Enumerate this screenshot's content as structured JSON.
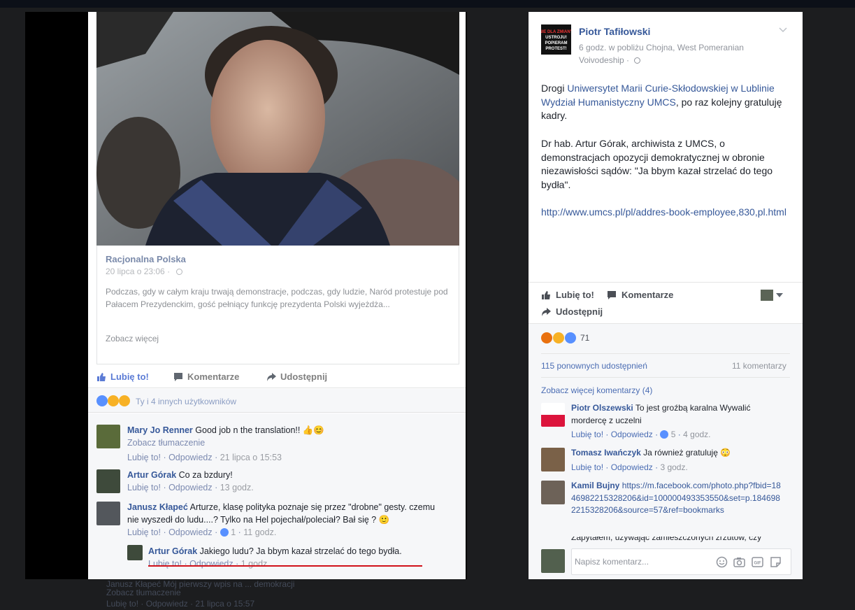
{
  "left": {
    "shared_post": {
      "source": "Racjonalna Polska",
      "date": "20 lipca o 23:06 · ",
      "excerpt": "Podczas, gdy w całym kraju trwają demonstracje, podczas, gdy ludzie, Naród protestuje pod Pałacem Prezydenckim, gość pełniący funkcję prezydenta Polski wyjeżdża...",
      "see_more": "Zobacz więcej"
    },
    "actions": {
      "like": "Lubię to!",
      "comment": "Komentarze",
      "share": "Udostępnij"
    },
    "reactions_text": "Ty i 4 innych użytkowników",
    "comments": [
      {
        "name": "Mary Jo Renner",
        "text": "Good job n the translation!! 👍😊",
        "translate": "Zobacz tłumaczenie",
        "like": "Lubię to!",
        "reply": "Odpowiedz",
        "date": "21 lipca o 15:53"
      },
      {
        "name": "Artur Górak",
        "text": "Co za bzdury!",
        "like": "Lubię to!",
        "reply": "Odpowiedz",
        "date": "13 godz."
      },
      {
        "name": "Janusz Kłapeć",
        "text_line1": "Arturze, klasę polityka poznaje się przez \"drobne\" gesty. czemu",
        "text_line2": "nie wyszedł do ludu....? Tylko na Hel pojechał/poleciał? Bał się ? 🙂",
        "like": "Lubię to!",
        "reply": "Odpowiedz",
        "reactions": "1",
        "date": "11 godz."
      },
      {
        "name": "Artur Górak",
        "text": "Jakiego ludu? Ja bbym kazał strzelać do tego bydła.",
        "like": "Lubię to!",
        "reply": "Odpowiedz",
        "date": "1 godz."
      }
    ],
    "ghost": {
      "line1": "Janusz Kłapeć  Mój pierwszy wpis na ... demokracji",
      "line2": "Zobacz tłumaczenie",
      "line3": "Lubię to!  ·  Odpowiedz  ·  21 lipca o 15:57"
    }
  },
  "right": {
    "author": "Piotr Tafiłowski",
    "avatar_caption": "NIE DLA ZMIANY USTROJU! POPIERAM PROTEST!",
    "meta": "6 godz. w pobliżu Chojna, West Pomeranian Voivodeship · ",
    "body": {
      "p1_a": "Drogi ",
      "p1_link": "Uniwersytet Marii Curie-Skłodowskiej w Lublinie Wydział Humanistyczny UMCS",
      "p1_b": ", po raz kolejny gratuluję kadry.",
      "p2": "Dr hab. Artur Górak, archiwista z UMCS, o demonstracjach opozycji demokratycznej w obronie niezawisłości sądów: \"Ja bbym kazał strzelać do tego bydła\".",
      "p3_link": "http://www.umcs.pl/pl/addres-book-employee,830,pl.html"
    },
    "actions": {
      "like": "Lubię to!",
      "comment": "Komentarze",
      "share": "Udostępnij"
    },
    "reactions_count": "71",
    "shares": "115 ponownych udostępnień",
    "comments_count": "11 komentarzy",
    "more_comments": "Zobacz więcej komentarzy (4)",
    "comments": [
      {
        "name": "Piotr Olszewski",
        "text": "To jest groźbą karalna Wywalić mordercę z uczelni",
        "like": "Lubię to!",
        "reply": "Odpowiedz",
        "reactions": "5",
        "date": "4 godz."
      },
      {
        "name": "Tomasz Iwańczyk",
        "text": "Ja również gratuluję 😳",
        "like": "Lubię to!",
        "reply": "Odpowiedz",
        "date": "3 godz."
      },
      {
        "name": "Kamil Bujny",
        "link": "https://m.facebook.com/photo.php?fbid=1846982215328206&id=100000493353550&set=p.1846982215328206&source=57&ref=bookmarks"
      },
      {
        "partial": "Zapytałem, używając zamieszczonych zrzutów, czy"
      }
    ],
    "comment_placeholder": "Napisz komentarz..."
  }
}
